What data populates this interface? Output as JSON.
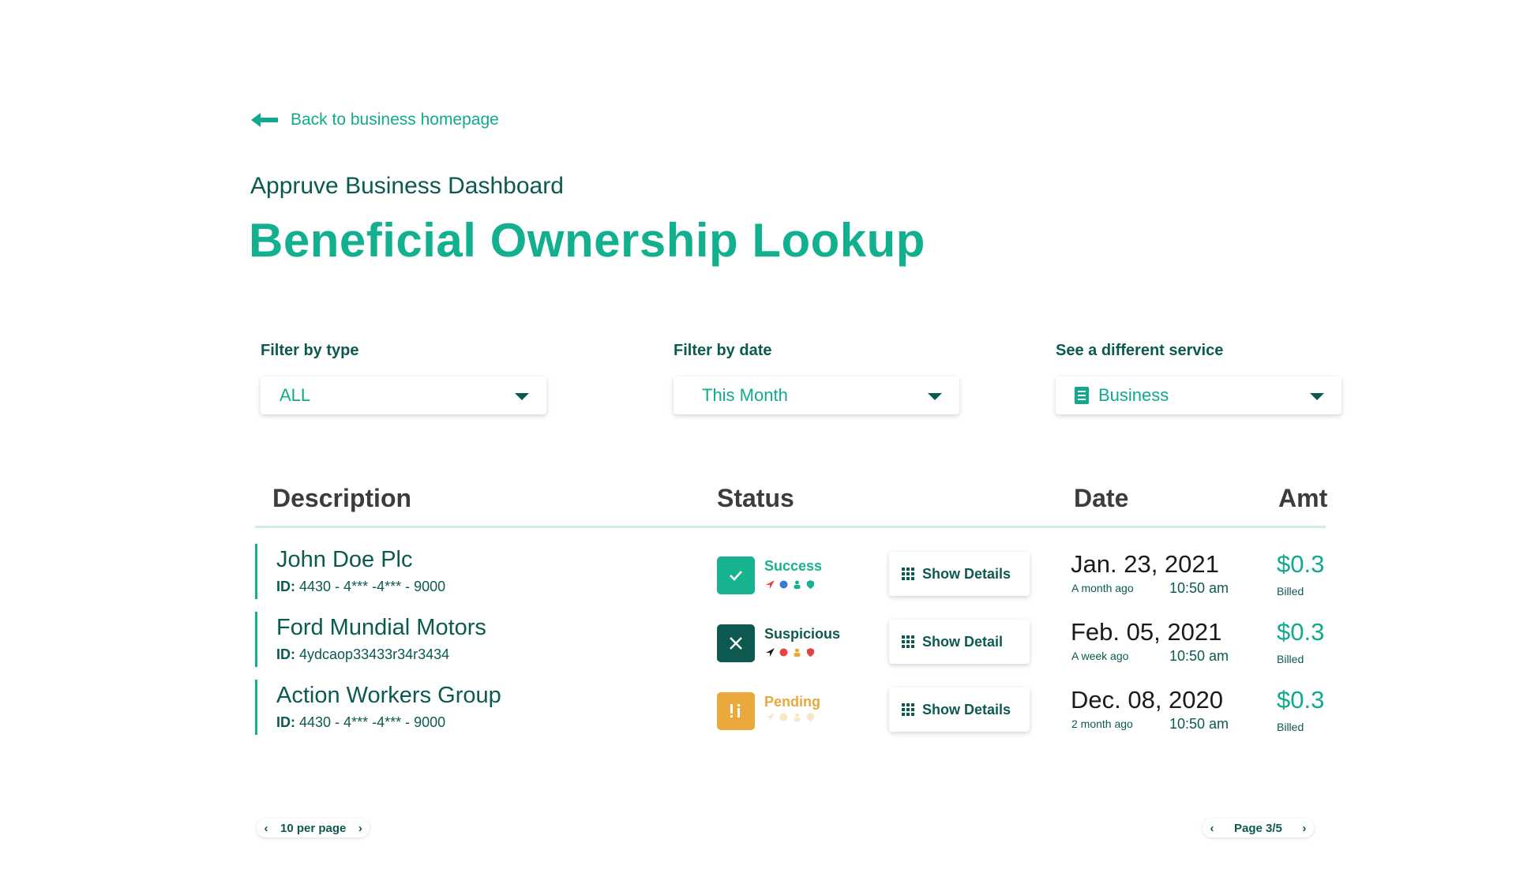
{
  "nav": {
    "back_label": "Back to business homepage"
  },
  "header": {
    "subtitle": "Appruve Business Dashboard",
    "title": "Beneficial Ownership Lookup"
  },
  "filters": {
    "type": {
      "label": "Filter by type",
      "value": "ALL"
    },
    "date": {
      "label": "Filter by date",
      "value": "This Month"
    },
    "service": {
      "label": "See a different service",
      "value": "Business"
    }
  },
  "table": {
    "headers": {
      "description": "Description",
      "status": "Status",
      "date": "Date",
      "amount": "Amt"
    },
    "rows": [
      {
        "name": "John Doe Plc",
        "id_label": "ID:",
        "id_value": "4430 - 4*** -4*** - 9000",
        "status": "Success",
        "status_icon": "check-icon",
        "details_label": "Show Details",
        "date": "Jan.  23,  2021",
        "relative": "A month ago",
        "time": "10:50 am",
        "amount": "$0.3",
        "billed": "Billed"
      },
      {
        "name": "Ford Mundial Motors",
        "id_label": "ID:",
        "id_value": "4ydcaop33433r34r3434",
        "status": "Suspicious",
        "status_icon": "x-icon",
        "details_label": "Show Detail",
        "date": "Feb. 05,  2021",
        "relative": "A week ago",
        "time": "10:50 am",
        "amount": "$0.3",
        "billed": "Billed"
      },
      {
        "name": "Action Workers Group",
        "id_label": "ID:",
        "id_value": "4430 - 4*** -4*** - 9000",
        "status": "Pending",
        "status_icon": "exclamation-info-icon",
        "details_label": "Show Details",
        "date": "Dec. 08,  2020",
        "relative": "2 month ago",
        "time": "10:50 am",
        "amount": "$0.3",
        "billed": "Billed"
      }
    ]
  },
  "pagination": {
    "per_page": "10 per page",
    "page": "Page 3/5"
  },
  "colors": {
    "primary": "#12b08f",
    "dark": "#0b5a4f",
    "success": "#17b28e",
    "suspicious": "#0f5a50",
    "pending": "#e9a93c",
    "red": "#e84343",
    "blue": "#3a7bd5"
  }
}
